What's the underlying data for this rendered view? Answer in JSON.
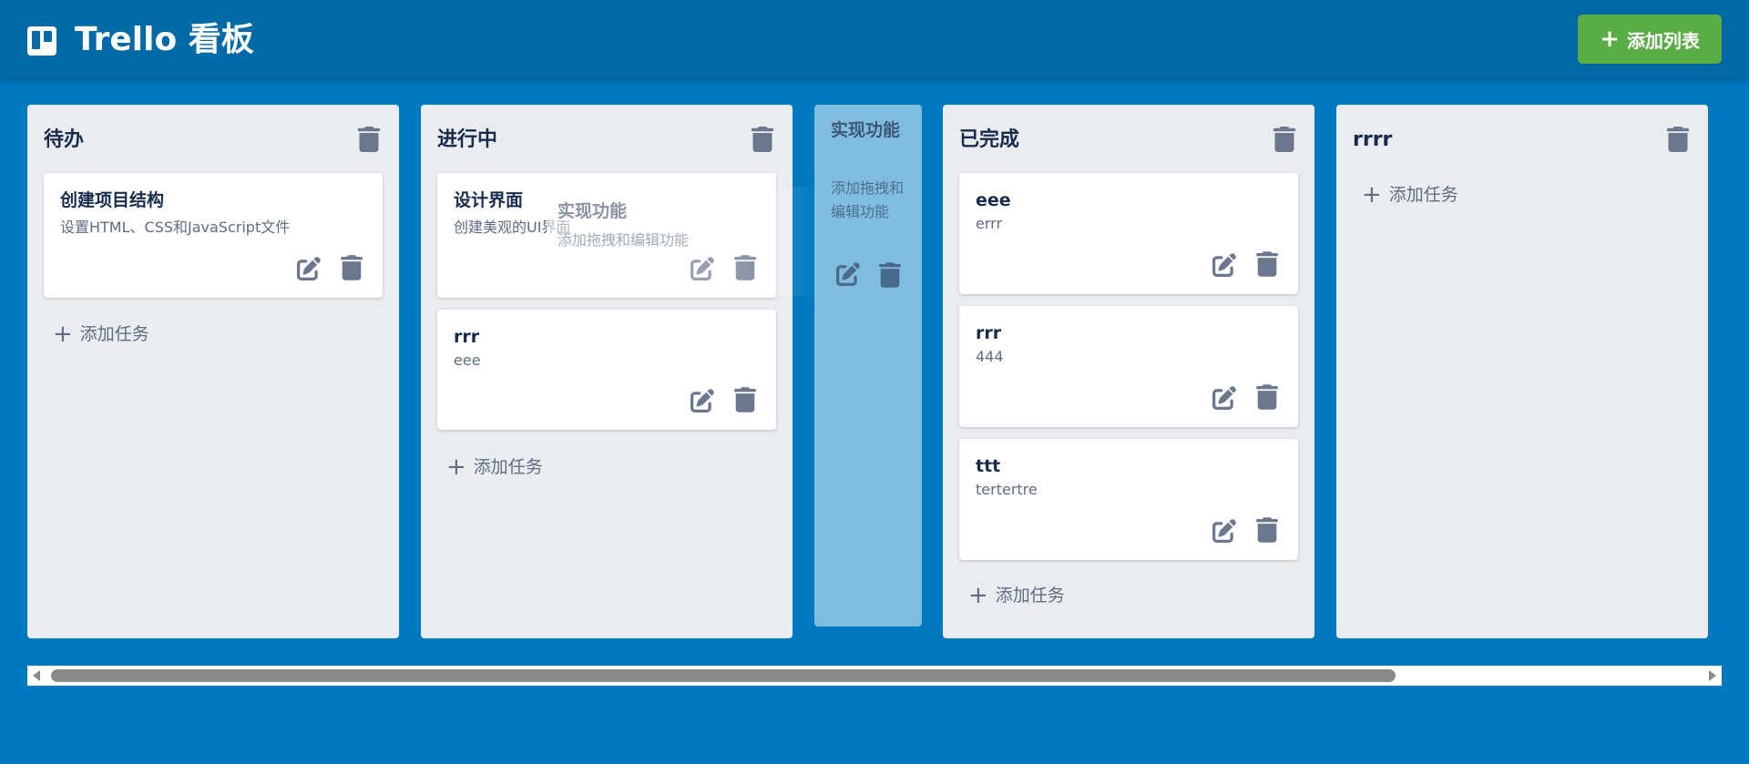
{
  "header": {
    "title": "Trello 看板",
    "logo_icon": "trello-board-icon",
    "add_list_label": "添加列表",
    "add_list_icon": "plus-icon"
  },
  "colors": {
    "header_bg": "#026aa7",
    "board_bg": "#0079bf",
    "add_list_btn": "#5aac44",
    "list_bg": "#ebecf0",
    "card_bg": "#ffffff",
    "icon_gray": "#6b778c"
  },
  "lists": [
    {
      "title": "待办",
      "cards": [
        {
          "title": "创建项目结构",
          "description": "设置HTML、CSS和JavaScript文件"
        }
      ],
      "add_task_label": "添加任务"
    },
    {
      "title": "进行中",
      "cards": [
        {
          "title": "设计界面",
          "description": "创建美观的UI界面"
        },
        {
          "title": "rrr",
          "description": "eee"
        }
      ],
      "add_task_label": "添加任务"
    },
    {
      "title": "已完成",
      "cards": [
        {
          "title": "eee",
          "description": "errr"
        },
        {
          "title": "rrr",
          "description": "444"
        },
        {
          "title": "ttt",
          "description": "tertertre"
        }
      ],
      "add_task_label": "添加任务"
    },
    {
      "title": "rrrr",
      "cards": [],
      "add_task_label": "添加任务"
    }
  ],
  "dragging_card": {
    "title": "实现功能",
    "description": "添加拖拽和编辑功能"
  }
}
